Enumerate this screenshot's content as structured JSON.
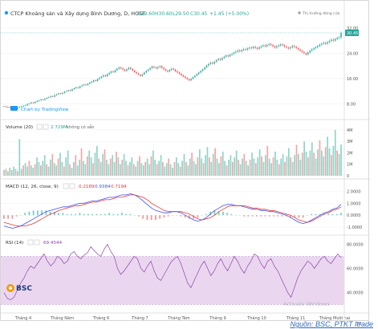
{
  "chart_data": [
    {
      "type": "candlestick",
      "title": "CTCP Khoáng sản và Xây dựng Bình Dương, D, HOSE",
      "ohlc_header": {
        "open": "O29.60",
        "high": "H30.60",
        "low": "L29.50",
        "close": "C30.45",
        "change": "+1.45 (+5.00%)"
      },
      "market_status": "Thị trường đóng cửa",
      "watermark": "Chart by TradingView",
      "price_axis_ticks": [
        32.0,
        24.0,
        16.0,
        8.0
      ],
      "last_price_label": "30.45",
      "close_series": [
        7.2,
        7.0,
        6.8,
        6.9,
        6.6,
        6.4,
        6.5,
        6.8,
        7.0,
        7.2,
        7.3,
        7.5,
        7.9,
        8.1,
        8.4,
        8.2,
        8.6,
        8.9,
        9.1,
        9.4,
        9.2,
        9.6,
        9.9,
        10.1,
        10.4,
        10.2,
        10.7,
        11.0,
        11.3,
        11.1,
        11.4,
        11.8,
        12.0,
        12.3,
        12.1,
        12.6,
        12.9,
        13.2,
        13.0,
        13.5,
        13.8,
        14.1,
        13.9,
        14.3,
        14.7,
        15.0,
        15.4,
        15.2,
        15.8,
        16.2,
        16.6,
        17.0,
        16.7,
        17.3,
        17.8,
        18.2,
        18.0,
        18.6,
        19.1,
        19.5,
        19.2,
        18.8,
        18.4,
        18.9,
        19.4,
        19.0,
        18.5,
        18.0,
        17.6,
        17.2,
        16.8,
        17.3,
        17.9,
        18.4,
        18.8,
        19.3,
        19.8,
        19.5,
        19.2,
        19.6,
        19.9,
        19.4,
        18.9,
        18.5,
        18.2,
        18.7,
        19.1,
        18.8,
        18.3,
        17.9,
        17.5,
        17.0,
        16.6,
        16.2,
        15.8,
        15.4,
        15.9,
        16.4,
        16.9,
        17.4,
        17.9,
        18.4,
        18.9,
        19.5,
        20.1,
        20.6,
        21.0,
        20.7,
        21.3,
        21.8,
        22.2,
        21.9,
        22.5,
        22.9,
        23.3,
        23.0,
        23.5,
        23.8,
        24.2,
        24.5,
        24.9,
        24.6,
        25.0,
        25.3,
        25.1,
        25.5,
        25.8,
        25.6,
        26.0,
        25.7,
        25.4,
        25.9,
        26.2,
        26.5,
        26.2,
        26.6,
        26.9,
        26.6,
        26.2,
        25.8,
        26.2,
        26.5,
        26.8,
        26.5,
        26.1,
        25.8,
        25.5,
        25.9,
        26.3,
        26.0,
        25.6,
        25.2,
        24.8,
        24.4,
        24.0,
        23.6,
        24.2,
        24.8,
        25.2,
        25.6,
        25.9,
        26.3,
        26.7,
        27.0,
        27.3,
        27.0,
        27.5,
        27.9,
        28.3,
        28.0,
        28.5,
        28.9,
        29.0,
        30.45
      ],
      "volume_label": "Volume (20)",
      "volume_value": "2.729M",
      "volume_extra": "không có sẵn",
      "volume_axis_ticks": [
        "4M",
        "3M",
        "2M",
        "1M",
        "0"
      ],
      "volume_series": [
        0.5,
        0.6,
        0.4,
        0.7,
        0.5,
        0.8,
        0.6,
        0.4,
        3.2,
        0.6,
        0.9,
        1.1,
        0.8,
        1.3,
        0.9,
        0.7,
        1.0,
        1.6,
        1.2,
        0.9,
        1.3,
        1.8,
        1.0,
        0.8,
        1.4,
        1.9,
        1.1,
        0.9,
        1.5,
        2.0,
        1.2,
        0.8,
        1.6,
        2.2,
        1.0,
        0.7,
        1.2,
        1.8,
        0.9,
        1.4,
        2.4,
        1.3,
        1.0,
        1.7,
        2.2,
        1.6,
        1.1,
        2.0,
        2.6,
        1.5,
        1.2,
        1.9,
        2.3,
        1.4,
        1.0,
        1.5,
        1.8,
        1.2,
        2.1,
        1.6,
        1.0,
        1.4,
        1.9,
        1.3,
        0.9,
        1.2,
        1.6,
        1.0,
        0.8,
        1.3,
        1.7,
        1.1,
        0.9,
        1.2,
        1.5,
        1.0,
        1.7,
        2.2,
        1.4,
        1.0,
        1.3,
        1.8,
        1.2,
        0.8,
        1.1,
        1.5,
        1.0,
        0.7,
        1.2,
        1.6,
        1.1,
        0.8,
        1.3,
        1.9,
        1.2,
        0.9,
        1.5,
        2.0,
        1.3,
        1.0,
        1.6,
        2.3,
        1.5,
        1.1,
        1.8,
        2.5,
        1.6,
        1.2,
        1.9,
        2.4,
        1.5,
        1.1,
        1.7,
        2.1,
        1.3,
        0.9,
        1.4,
        1.8,
        1.2,
        1.6,
        2.2,
        1.4,
        1.0,
        1.5,
        1.9,
        1.3,
        0.9,
        1.4,
        2.0,
        1.5,
        1.1,
        1.6,
        2.3,
        1.7,
        1.2,
        1.8,
        2.6,
        1.5,
        1.1,
        1.6,
        2.1,
        1.4,
        1.0,
        1.5,
        1.9,
        1.2,
        1.7,
        2.4,
        1.6,
        1.2,
        1.8,
        2.7,
        1.9,
        1.4,
        2.0,
        3.0,
        2.1,
        1.6,
        2.2,
        2.9,
        2.0,
        1.5,
        2.3,
        3.1,
        2.2,
        1.7,
        2.5,
        3.4,
        2.4,
        1.8,
        2.6,
        4.0,
        2.2,
        1.9,
        2.73
      ],
      "macd_label": "MACD (12, 26, close, 9)",
      "macd_values": {
        "macd": "0.2189",
        "signal": "0.9384",
        "hist": "0.7194"
      },
      "macd_axis_ticks": [
        "2.0000",
        "1.0000",
        "0.0000",
        "-1.0000"
      ],
      "macd_series": [
        -0.9,
        -1.0,
        -1.1,
        -1.0,
        -0.9,
        -0.7,
        -0.5,
        -0.3,
        -0.1,
        0.1,
        0.3,
        0.4,
        0.5,
        0.6,
        0.7,
        0.7,
        0.8,
        0.9,
        1.0,
        1.0,
        1.1,
        1.2,
        1.2,
        1.3,
        1.4,
        1.5,
        1.5,
        1.6,
        1.7,
        1.7,
        1.8,
        1.7,
        1.5,
        1.2,
        0.9,
        0.6,
        0.4,
        0.3,
        0.2,
        0.2,
        0.3,
        0.3,
        0.2,
        0.0,
        -0.2,
        -0.4,
        -0.5,
        -0.4,
        -0.2,
        0.1,
        0.4,
        0.6,
        0.8,
        0.9,
        0.9,
        0.8,
        0.8,
        0.7,
        0.6,
        0.5,
        0.5,
        0.4,
        0.4,
        0.3,
        0.3,
        0.2,
        0.1,
        0.0,
        -0.2,
        -0.4,
        -0.6,
        -0.7,
        -0.6,
        -0.4,
        -0.2,
        0.0,
        0.2,
        0.3,
        0.5,
        0.6,
        0.9
      ],
      "macd_signal_series": [
        -0.6,
        -0.7,
        -0.8,
        -0.9,
        -0.9,
        -0.9,
        -0.8,
        -0.7,
        -0.5,
        -0.3,
        -0.1,
        0.1,
        0.2,
        0.4,
        0.5,
        0.6,
        0.7,
        0.8,
        0.8,
        0.9,
        1.0,
        1.1,
        1.1,
        1.2,
        1.3,
        1.3,
        1.4,
        1.5,
        1.5,
        1.6,
        1.7,
        1.7,
        1.6,
        1.5,
        1.3,
        1.0,
        0.8,
        0.6,
        0.4,
        0.3,
        0.3,
        0.3,
        0.3,
        0.2,
        0.1,
        -0.1,
        -0.3,
        -0.4,
        -0.3,
        -0.2,
        0.0,
        0.3,
        0.5,
        0.7,
        0.8,
        0.8,
        0.8,
        0.8,
        0.7,
        0.6,
        0.6,
        0.5,
        0.5,
        0.4,
        0.4,
        0.3,
        0.2,
        0.1,
        0.0,
        -0.2,
        -0.4,
        -0.5,
        -0.6,
        -0.5,
        -0.3,
        -0.1,
        0.1,
        0.2,
        0.4,
        0.5,
        0.7
      ],
      "rsi_label": "RSI (14)",
      "rsi_value": "69.4544",
      "rsi_axis_ticks": [
        "80.0000",
        "60.0000",
        "40.0000"
      ],
      "rsi_band": [
        30,
        70
      ],
      "rsi_series": [
        40,
        35,
        34,
        36,
        42,
        48,
        52,
        58,
        62,
        60,
        64,
        68,
        72,
        66,
        62,
        65,
        70,
        68,
        64,
        66,
        72,
        74,
        70,
        68,
        71,
        73,
        78,
        75,
        72,
        70,
        76,
        80,
        74,
        70,
        60,
        55,
        58,
        62,
        66,
        70,
        68,
        60,
        57,
        62,
        66,
        58,
        52,
        50,
        55,
        60,
        65,
        68,
        70,
        64,
        56,
        48,
        44,
        50,
        56,
        62,
        66,
        60,
        54,
        58,
        64,
        68,
        62,
        58,
        64,
        70,
        66,
        60,
        56,
        62,
        66,
        72,
        70,
        64,
        60,
        66,
        68,
        62,
        58,
        52,
        46,
        40,
        36,
        44,
        52,
        58,
        62,
        66,
        64,
        60,
        64,
        68,
        70,
        66,
        64,
        68,
        72,
        69
      ],
      "x_tick_labels": [
        "Tháng 4",
        "Tháng Năm",
        "Tháng 6",
        "Tháng 7",
        "Tháng Tám",
        "Tháng 9",
        "Tháng 10",
        "Tháng 11",
        "Tháng Mười hai"
      ],
      "corner_label": "10",
      "colors": {
        "up": "#26a69a",
        "down": "#ef5350",
        "macd": "#3f51f5",
        "signal": "#e53935",
        "rsi": "#8e44ad",
        "rsi_band": "#ead7ef",
        "volume_up": "#8fd3c8",
        "volume_down": "#f2a5a4"
      }
    }
  ],
  "logo": "BSC",
  "rsi_watermark": "Activate Windows",
  "source": "Nguồn: BSC, PTKT Itrade"
}
